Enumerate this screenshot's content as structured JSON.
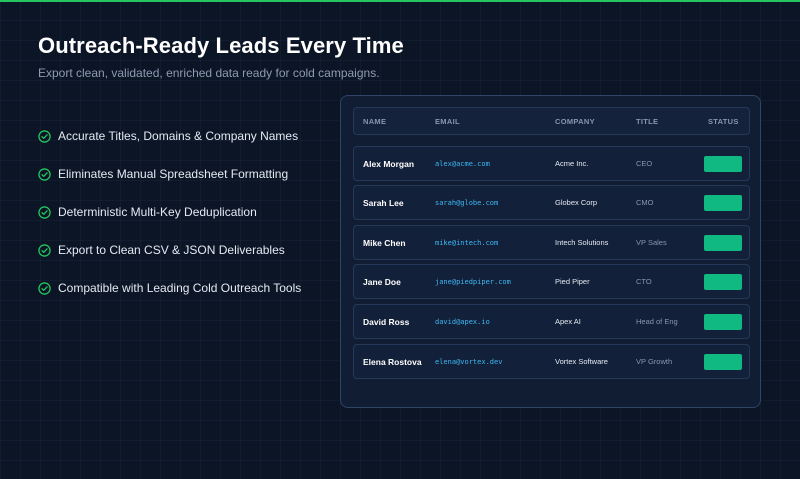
{
  "colors": {
    "accent": "#22c55e",
    "status_fill": "#10b981",
    "email_text": "#3db8f5",
    "background": "#0c1526"
  },
  "hero": {
    "title": "Outreach-Ready Leads Every Time",
    "subtitle": "Export clean, validated, enriched data ready for cold campaigns."
  },
  "features": [
    {
      "icon": "check-circle-icon",
      "text": "Accurate Titles, Domains & Company Names"
    },
    {
      "icon": "check-circle-icon",
      "text": "Eliminates Manual Spreadsheet Formatting"
    },
    {
      "icon": "check-circle-icon",
      "text": "Deterministic Multi-Key Deduplication"
    },
    {
      "icon": "check-circle-icon",
      "text": "Export to Clean CSV & JSON Deliverables"
    },
    {
      "icon": "check-circle-icon",
      "text": "Compatible with Leading Cold Outreach Tools"
    }
  ],
  "table": {
    "columns": [
      "NAME",
      "EMAIL",
      "COMPANY",
      "TITLE",
      "STATUS"
    ],
    "rows": [
      {
        "name": "Alex Morgan",
        "email": "alex@acme.com",
        "company": "Acme Inc.",
        "title": "CEO"
      },
      {
        "name": "Sarah Lee",
        "email": "sarah@globe.com",
        "company": "Globex Corp",
        "title": "CMO"
      },
      {
        "name": "Mike Chen",
        "email": "mike@intech.com",
        "company": "Intech Solutions",
        "title": "VP Sales"
      },
      {
        "name": "Jane Doe",
        "email": "jane@piedpiper.com",
        "company": "Pied Piper",
        "title": "CTO"
      },
      {
        "name": "David Ross",
        "email": "david@apex.io",
        "company": "Apex AI",
        "title": "Head of Eng"
      },
      {
        "name": "Elena Rostova",
        "email": "elena@vortex.dev",
        "company": "Vortex Software",
        "title": "VP Growth"
      }
    ]
  }
}
